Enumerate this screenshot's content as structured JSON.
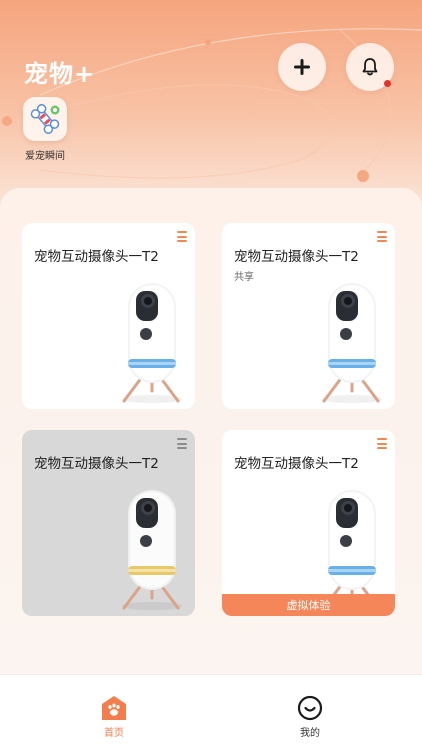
{
  "header": {
    "app_title": "宠物+",
    "add_icon": "plus-icon",
    "bell_icon": "bell-icon",
    "bell_badge_color": "#e5322d"
  },
  "shortcuts": [
    {
      "label": "爱宠瞬间",
      "icon": "pet-moments-icon"
    }
  ],
  "devices": [
    {
      "name": "宠物互动摄像头一T2",
      "subtitle": "",
      "status": "online",
      "ring_color": "#5aa7e6"
    },
    {
      "name": "宠物互动摄像头一T2",
      "subtitle": "共享",
      "status": "online",
      "ring_color": "#5aa7e6"
    },
    {
      "name": "宠物互动摄像头一T2",
      "subtitle": "",
      "status": "offline",
      "ring_color": "#e6c35a"
    },
    {
      "name": "宠物互动摄像头一T2",
      "subtitle": "",
      "status": "virtual",
      "ring_color": "#5aa7e6",
      "badge": "虚拟体验"
    }
  ],
  "tabbar": {
    "home": "首页",
    "mine": "我的",
    "active_color": "#f37d4c"
  },
  "colors": {
    "accent": "#f5865a",
    "offline_card": "#d8d8d8"
  }
}
